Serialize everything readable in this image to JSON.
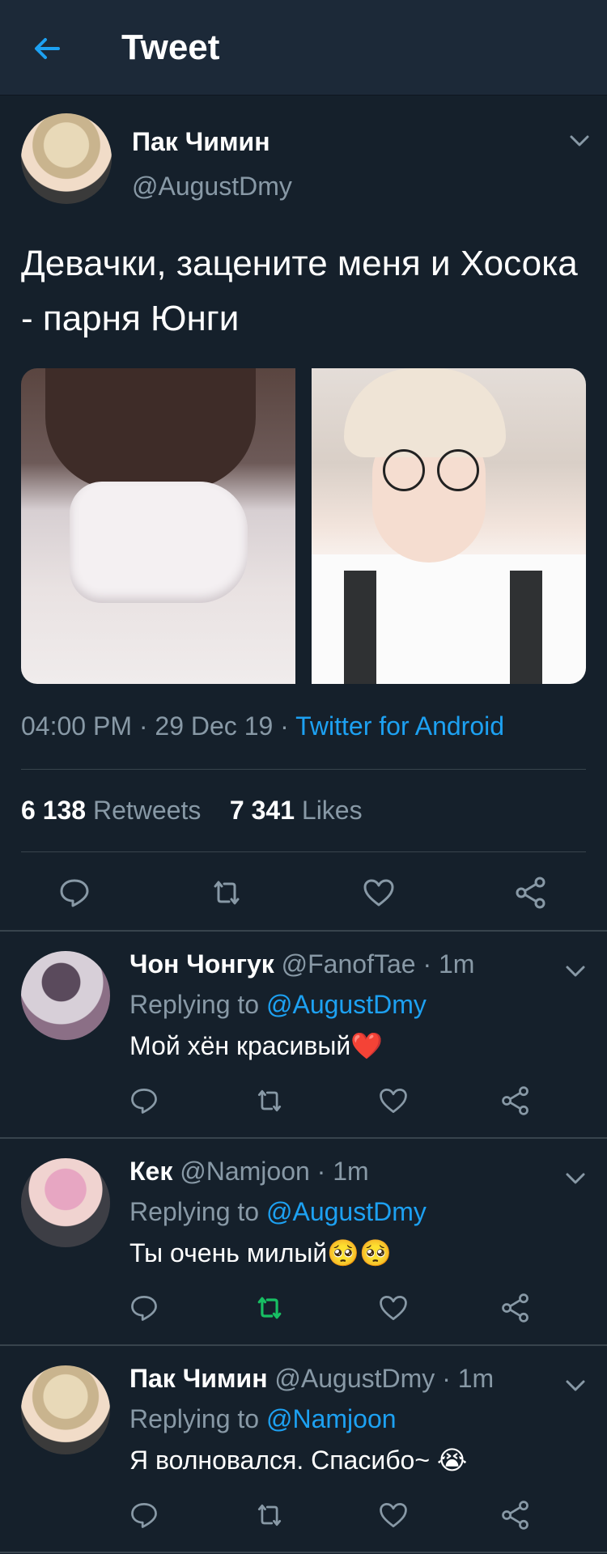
{
  "header": {
    "title": "Tweet",
    "back_icon": "arrow-left-icon"
  },
  "colors": {
    "background": "#15202b",
    "header": "#1c2938",
    "accent": "#1da1f2",
    "muted": "#8899a6",
    "retweet_active": "#17bf63"
  },
  "main_tweet": {
    "name": "Пак Чимин",
    "handle": "@AugustDmy",
    "text": "Девачки, зацените меня и Хосока - парня Юнги",
    "time": "04:00 PM",
    "date": "29 Dec 19",
    "source": "Twitter for Android",
    "retweets_count": "6 138",
    "retweets_label": "Retweets",
    "likes_count": "7 341",
    "likes_label": "Likes",
    "sep": "·"
  },
  "replies": [
    {
      "name": "Чон Чонгук",
      "handle": "@FanofTae",
      "time": "1m",
      "replying_label": "Replying to",
      "replying_to": "@AugustDmy",
      "text": "Мой хён красивый",
      "emoji": "❤️",
      "retweeted": false
    },
    {
      "name": "Кек",
      "handle": "@Namjoon",
      "time": "1m",
      "replying_label": "Replying to",
      "replying_to": "@AugustDmy",
      "text": "Ты очень милый",
      "emoji": "🥺🥺",
      "retweeted": true
    },
    {
      "name": "Пак Чимин",
      "handle": "@AugustDmy",
      "time": "1m",
      "replying_label": "Replying to",
      "replying_to": "@Namjoon",
      "text": "Я волновался. Спасибо~ ",
      "emoji": "😭",
      "retweeted": false
    }
  ]
}
